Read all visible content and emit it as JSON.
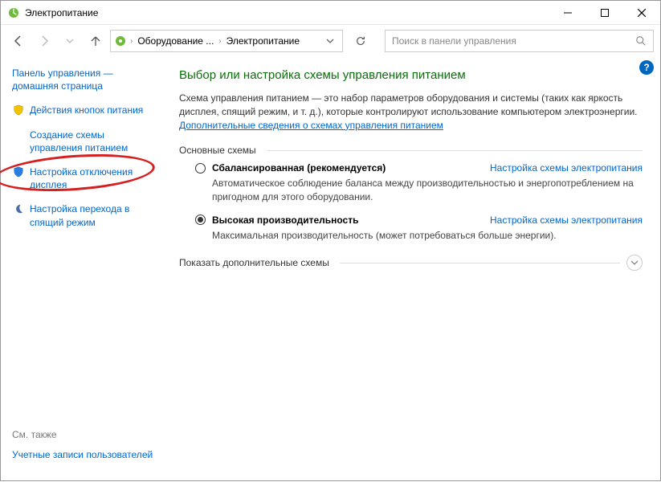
{
  "window": {
    "title": "Электропитание"
  },
  "breadcrumb": {
    "item1": "Оборудование ...",
    "item2": "Электропитание"
  },
  "search": {
    "placeholder": "Поиск в панели управления"
  },
  "sidebar": {
    "home": "Панель управления — домашняя страница",
    "items": [
      "Действия кнопок питания",
      "Создание схемы управления питанием",
      "Настройка отключения дисплея",
      "Настройка перехода в спящий режим"
    ],
    "see_also_heading": "См. также",
    "see_also": "Учетные записи пользователей"
  },
  "main": {
    "heading": "Выбор или настройка схемы управления питанием",
    "description_part1": "Схема управления питанием — это набор параметров оборудования и системы (таких как яркость дисплея, спящий режим, и т. д.), которые контролируют использование компьютером электроэнергии.",
    "description_link": "Дополнительные сведения о схемах управления питанием",
    "section_title": "Основные схемы",
    "plans": [
      {
        "name": "Сбалансированная (рекомендуется)",
        "selected": false,
        "desc": "Автоматическое соблюдение баланса между производительностью и энергопотреблением на пригодном для этого оборудовании.",
        "link": "Настройка схемы электропитания"
      },
      {
        "name": "Высокая производительность",
        "selected": true,
        "desc": "Максимальная производительность (может потребоваться больше энергии).",
        "link": "Настройка схемы электропитания"
      }
    ],
    "show_additional": "Показать дополнительные схемы"
  }
}
